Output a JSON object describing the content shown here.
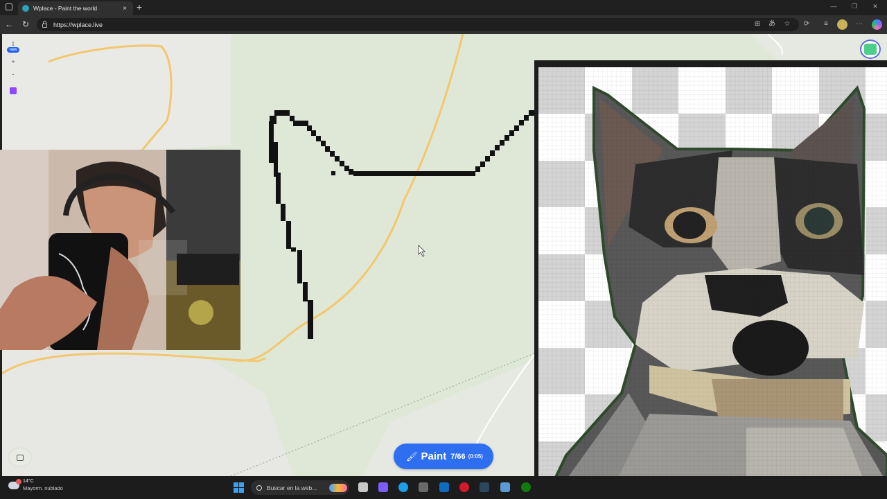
{
  "browser": {
    "tab_title": "Wplace - Paint the world",
    "new_tab_symbol": "+",
    "close_tab_symbol": "×",
    "url": "https://wplace.live",
    "window_controls": [
      "—",
      "❐",
      "✕"
    ]
  },
  "map": {
    "left_controls": {
      "info_symbol": "i",
      "new_badge": "new",
      "zoom_in": "+",
      "zoom_out": "-"
    }
  },
  "paint_button": {
    "label": "Paint",
    "count": "7/66",
    "timer": "(0:05)",
    "color": "#2e6ff2"
  },
  "logo_badge_count": "3",
  "taskbar": {
    "weather_temp": "14°C",
    "weather_desc": "Mayorm. nublado",
    "search_placeholder": "Buscar en la web...",
    "notification_badge": "3"
  },
  "colors": {
    "map_background": "#dfe8d6",
    "road": "#f3c76d",
    "pixel_stroke": "#111111"
  }
}
